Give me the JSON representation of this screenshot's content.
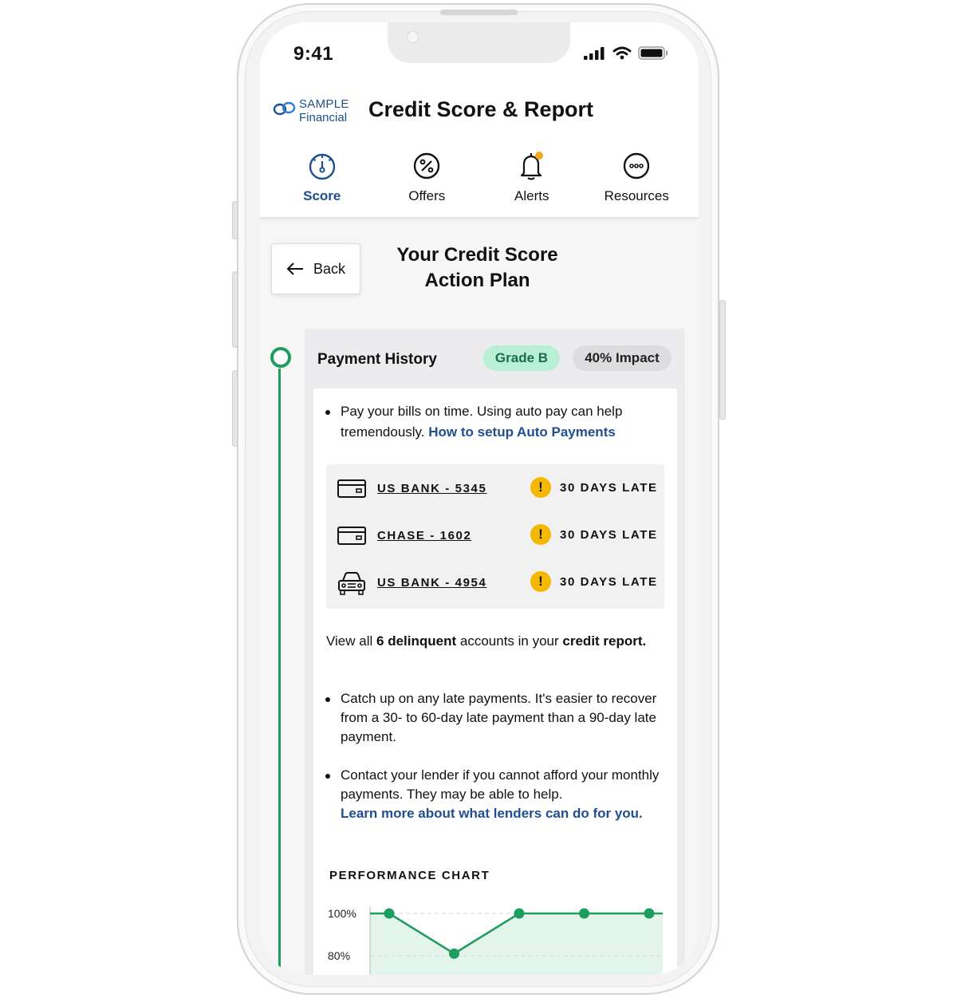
{
  "status_bar": {
    "time": "9:41"
  },
  "header": {
    "logo_line1": "SAMPLE",
    "logo_line2": "Financial",
    "title": "Credit Score & Report"
  },
  "tabs": [
    {
      "label": "Score",
      "icon": "speedometer-icon",
      "active": true
    },
    {
      "label": "Offers",
      "icon": "percent-icon",
      "active": false
    },
    {
      "label": "Alerts",
      "icon": "bell-icon",
      "active": false
    },
    {
      "label": "Resources",
      "icon": "more-icon",
      "active": false
    }
  ],
  "page": {
    "back_label": "Back",
    "title_line1": "Your Credit Score",
    "title_line2": "Action Plan"
  },
  "payment_history": {
    "title": "Payment History",
    "grade": "Grade B",
    "impact": "40% Impact",
    "bullet1_text": "Pay your bills on time. Using auto pay can help tremendously.",
    "bullet1_link": "How to setup Auto Payments",
    "accounts": [
      {
        "name": "US BANK - 5345",
        "icon": "credit-card-icon",
        "status": "30 DAYS LATE"
      },
      {
        "name": "CHASE - 1602",
        "icon": "credit-card-icon",
        "status": "30 DAYS LATE"
      },
      {
        "name": "US BANK - 4954",
        "icon": "car-icon",
        "status": "30 DAYS LATE"
      }
    ],
    "view_all_prefix": "View all",
    "view_all_count": "6 delinquent",
    "view_all_middle": "accounts in your",
    "view_all_link": "credit report.",
    "bullet2_text": "Catch up on any late payments. It's easier to recover from a 30- to 60-day late payment than a 90-day late payment.",
    "bullet3_text": "Contact your lender if you cannot afford your monthly payments. They may be able to help.",
    "bullet3_link": "Learn more about what lenders can do for you."
  },
  "colors": {
    "brand": "#1f4f8f",
    "accent_green": "#1e9e5e",
    "warning": "#f5b800",
    "alert_dot": "#f5a623"
  },
  "chart_data": {
    "type": "line",
    "title": "PERFORMANCE CHART",
    "y_ticks": [
      "100%",
      "80%"
    ],
    "ylim": [
      75,
      100
    ],
    "values": [
      100,
      81,
      100,
      100,
      100
    ],
    "grid": true
  }
}
